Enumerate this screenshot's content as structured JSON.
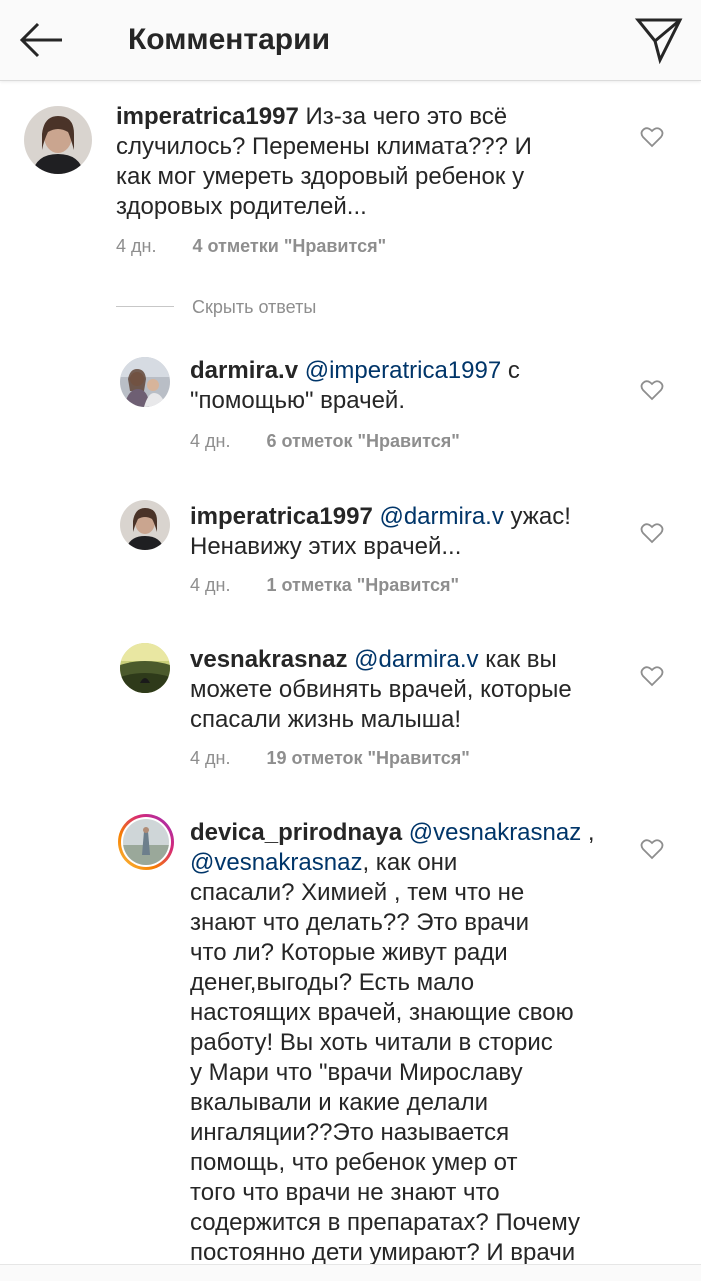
{
  "header": {
    "title": "Комментарии",
    "back_icon": "arrow-left-icon",
    "send_icon": "paper-plane-icon"
  },
  "colors": {
    "mention": "#003569",
    "meta": "#8e8e8e",
    "text": "#262626",
    "header_bg": "#fafafa"
  },
  "comments": [
    {
      "username": "imperatrica1997",
      "mention": "",
      "lines": [
        "Из-за чего это всё",
        "случилось? Перемены климата??? И",
        "как мог умереть здоровый ребенок у",
        "здоровых родителей..."
      ],
      "time": "4 дн.",
      "likes": "4 отметки \"Нравится\""
    },
    {
      "username": "darmira.v",
      "mention": "@imperatrica1997",
      "lines": [
        "с",
        "\"помощью\" врачей."
      ],
      "time": "4 дн.",
      "likes": "6 отметок \"Нравится\""
    },
    {
      "username": "imperatrica1997",
      "mention": "@darmira.v",
      "lines": [
        "ужас!",
        "Ненавижу этих врачей..."
      ],
      "time": "4 дн.",
      "likes": "1 отметка \"Нравится\""
    },
    {
      "username": "vesnakrasnaz",
      "mention": "@darmira.v",
      "lines": [
        "как вы",
        "можете обвинять врачей, которые",
        "спасали жизнь малыша!"
      ],
      "time": "4 дн.",
      "likes": "19 отметок \"Нравится\""
    },
    {
      "username": "devica_prirodnaya",
      "mention": "@vesnakrasnaz",
      "mention2": "@vesnakrasnaz",
      "lines": [
        ",",
        ", как они",
        "спасали? Химией , тем что не",
        "знают что делать?? Это врачи",
        "что ли? Которые живут ради",
        "денег,выгоды? Есть мало",
        "настоящих врачей, знающие свою",
        "работу! Вы хоть читали в сторис",
        "у Мари что \"врачи Мирославу",
        "вкалывали и какие делали",
        "ингаляции??Это называется",
        "помощь, что ребенок умер от",
        "того что врачи не знают что",
        "содержится в препаратах? Почему",
        "постоянно дети умирают? И врачи"
      ]
    }
  ],
  "hide_replies": "Скрыть ответы",
  "icons": {
    "like": "heart-outline-icon"
  }
}
